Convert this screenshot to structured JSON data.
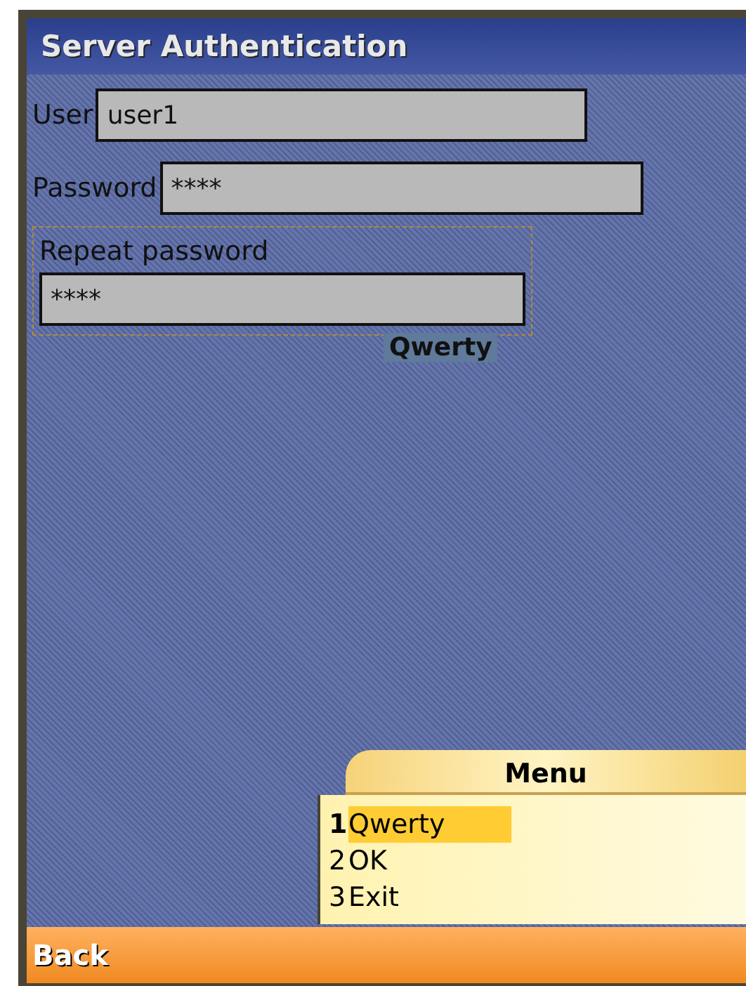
{
  "window": {
    "title": "Server Authentication"
  },
  "fields": [
    {
      "label": "User",
      "value": "user1",
      "focused": false,
      "kind": "inline"
    },
    {
      "label": "Password",
      "value": "****",
      "focused": false,
      "kind": "inline"
    },
    {
      "label": "Repeat password",
      "value": "****",
      "focused": true,
      "kind": "stacked"
    }
  ],
  "input_mode": "Qwerty",
  "menu": {
    "title": "Menu",
    "items": [
      {
        "number": "1",
        "label": "Qwerty",
        "selected": true
      },
      {
        "number": "2",
        "label": "OK",
        "selected": false
      },
      {
        "number": "3",
        "label": "Exit",
        "selected": false
      }
    ]
  },
  "softkey": "Back"
}
